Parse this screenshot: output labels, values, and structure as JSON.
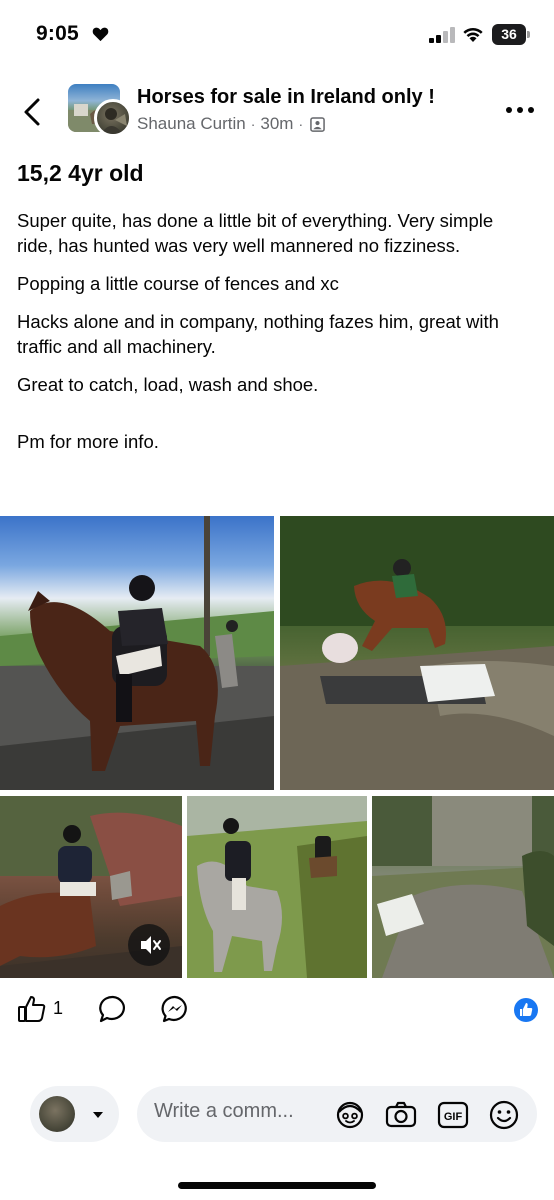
{
  "status_bar": {
    "time": "9:05",
    "battery": "36",
    "icons": [
      "heart-icon",
      "signal-icon",
      "wifi-icon",
      "battery-icon"
    ]
  },
  "header": {
    "group_name": "Horses for sale in Ireland only !",
    "author": "Shauna Curtin",
    "time_ago": "30m",
    "separator": "·"
  },
  "post": {
    "title": "15,2 4yr old",
    "paragraphs": [
      "Super quite, has done a little bit of everything. Very simple ride, has hunted was very well mannered no fizziness.",
      "Popping a little course of fences and xc",
      "Hacks alone and in company, nothing fazes him, great with traffic and all machinery.",
      "Great to catch, load, wash and shoe.",
      "Pm for more info."
    ]
  },
  "photos": [
    {
      "description": "rider-on-bay-horse-road"
    },
    {
      "description": "bay-horse-jumping-barrels"
    },
    {
      "description": "rider-on-bay-horse-video"
    },
    {
      "description": "rider-on-grey-horse-field"
    },
    {
      "description": "cross-country-fence-track"
    }
  ],
  "reactions": {
    "like_count": "1"
  },
  "composer": {
    "placeholder": "Write a comm..."
  },
  "colors": {
    "accent": "#1877f2",
    "secondary_text": "#65676b",
    "field_bg": "#f0f2f5"
  }
}
